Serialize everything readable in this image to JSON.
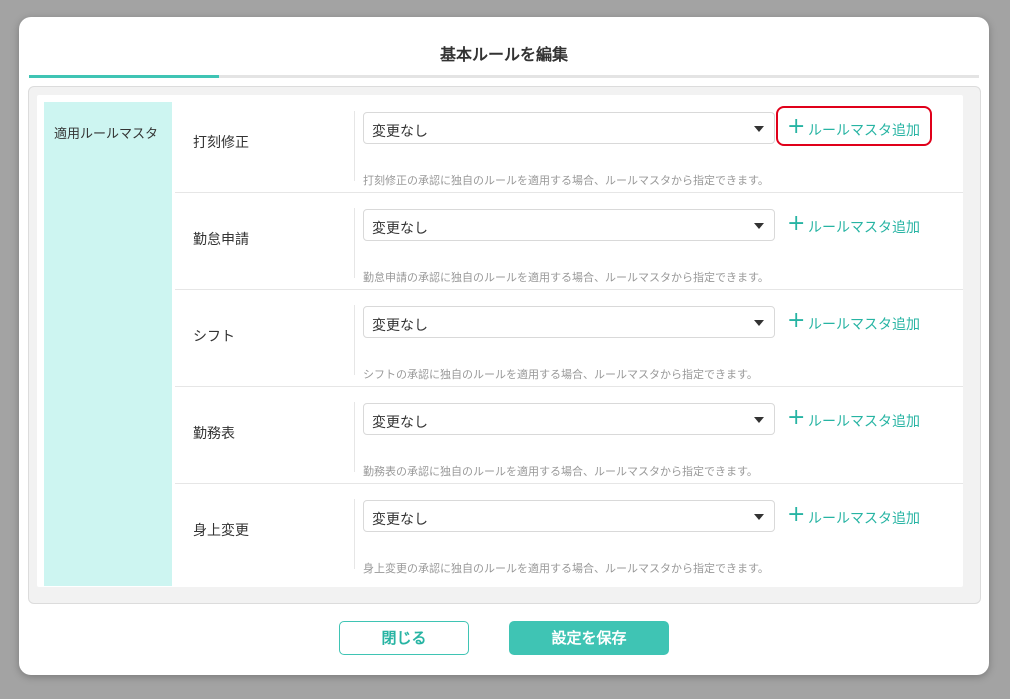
{
  "dialog": {
    "title": "基本ルールを編集"
  },
  "sidebar": {
    "label": "適用ルールマスタ"
  },
  "rows": [
    {
      "label": "打刻修正",
      "select_value": "変更なし",
      "add_label": "ルールマスタ追加",
      "hint": "打刻修正の承認に独自のルールを適用する場合、ルールマスタから指定できます。"
    },
    {
      "label": "勤怠申請",
      "select_value": "変更なし",
      "add_label": "ルールマスタ追加",
      "hint": "勤怠申請の承認に独自のルールを適用する場合、ルールマスタから指定できます。"
    },
    {
      "label": "シフト",
      "select_value": "変更なし",
      "add_label": "ルールマスタ追加",
      "hint": "シフトの承認に独自のルールを適用する場合、ルールマスタから指定できます。"
    },
    {
      "label": "勤務表",
      "select_value": "変更なし",
      "add_label": "ルールマスタ追加",
      "hint": "勤務表の承認に独自のルールを適用する場合、ルールマスタから指定できます。"
    },
    {
      "label": "身上変更",
      "select_value": "変更なし",
      "add_label": "ルールマスタ追加",
      "hint": "身上変更の承認に独自のルールを適用する場合、ルールマスタから指定できます。"
    }
  ],
  "footer": {
    "close_label": "閉じる",
    "save_label": "設定を保存"
  },
  "icons": {
    "add": "plus-icon",
    "dropdown": "chevron-down-icon"
  },
  "colors": {
    "accent": "#3fc4b4",
    "sidebar_bg": "#cdf5f1",
    "highlight": "#e0001a"
  }
}
